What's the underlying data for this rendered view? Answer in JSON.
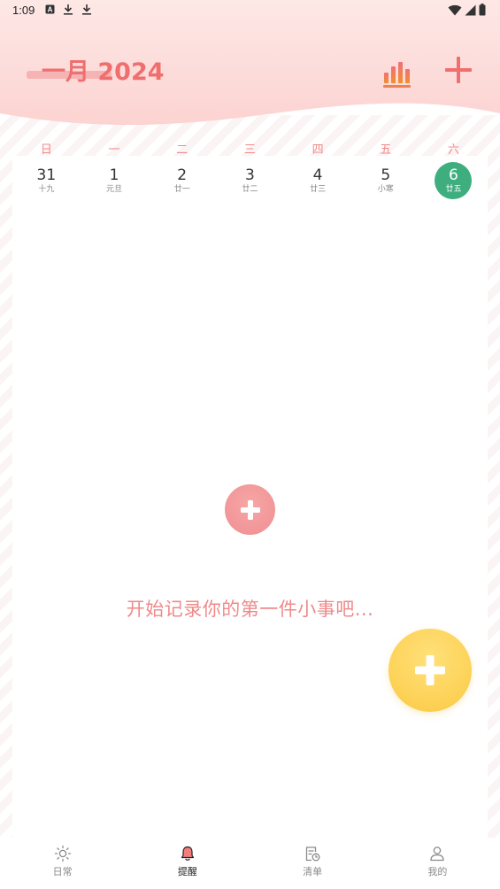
{
  "status_bar": {
    "time": "1:09",
    "left_icons": [
      "a-badge-icon",
      "download-icon",
      "download-icon"
    ],
    "right_icons": [
      "wifi-icon",
      "signal-icon",
      "battery-icon"
    ]
  },
  "header": {
    "month_title": "一月 2024",
    "stats_icon": "bar-chart-icon",
    "add_icon": "plus-icon"
  },
  "calendar": {
    "weekdays": [
      "日",
      "一",
      "二",
      "三",
      "四",
      "五",
      "六"
    ],
    "dates": [
      {
        "day": "31",
        "lunar": "十九",
        "selected": false
      },
      {
        "day": "1",
        "lunar": "元旦",
        "selected": false
      },
      {
        "day": "2",
        "lunar": "廿一",
        "selected": false
      },
      {
        "day": "3",
        "lunar": "廿二",
        "selected": false
      },
      {
        "day": "4",
        "lunar": "廿三",
        "selected": false
      },
      {
        "day": "5",
        "lunar": "小寒",
        "selected": false
      },
      {
        "day": "6",
        "lunar": "廿五",
        "selected": true
      }
    ]
  },
  "empty_state": {
    "hint": "开始记录你的第一件小事吧..."
  },
  "bottom_nav": {
    "items": [
      {
        "label": "日常",
        "icon": "sun-icon",
        "active": false
      },
      {
        "label": "提醒",
        "icon": "bell-icon",
        "active": true
      },
      {
        "label": "清单",
        "icon": "checklist-icon",
        "active": false
      },
      {
        "label": "我的",
        "icon": "profile-icon",
        "active": false
      }
    ]
  },
  "colors": {
    "accent_pink": "#ef6f6f",
    "selected_green": "#3fae7f",
    "fab_yellow": "#fdd35a",
    "nav_active_bell": "#ef6f6f"
  }
}
